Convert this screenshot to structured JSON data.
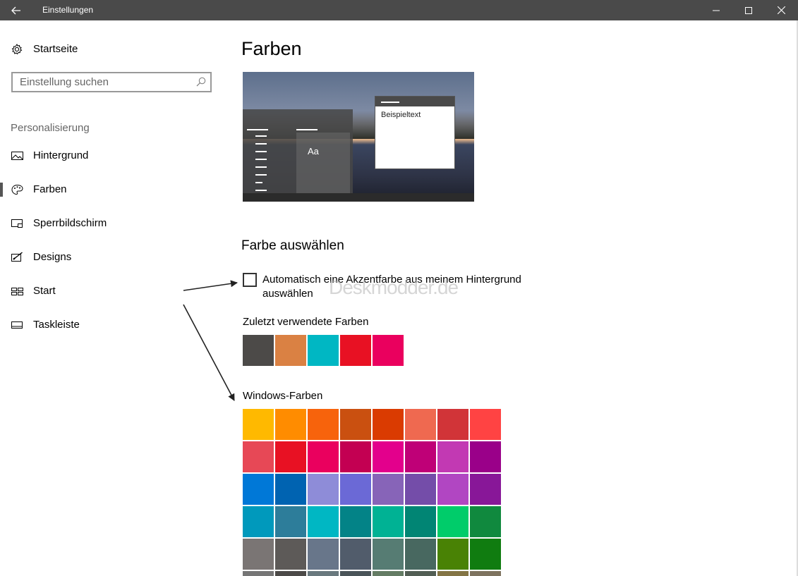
{
  "window": {
    "title": "Einstellungen"
  },
  "sidebar": {
    "home_label": "Startseite",
    "search_placeholder": "Einstellung suchen",
    "section_label": "Personalisierung",
    "items": [
      {
        "label": "Hintergrund",
        "icon": "image-icon"
      },
      {
        "label": "Farben",
        "icon": "palette-icon",
        "selected": true
      },
      {
        "label": "Sperrbildschirm",
        "icon": "lock-screen-icon"
      },
      {
        "label": "Designs",
        "icon": "brush-icon"
      },
      {
        "label": "Start",
        "icon": "start-tiles-icon"
      },
      {
        "label": "Taskleiste",
        "icon": "taskbar-icon"
      }
    ]
  },
  "main": {
    "title": "Farben",
    "preview": {
      "sample_text": "Beispieltext",
      "tile_text": "Aa"
    },
    "choose_heading": "Farbe auswählen",
    "auto_accent_label": "Automatisch eine Akzentfarbe aus meinem Hintergrund auswählen",
    "auto_accent_checked": false,
    "watermark": "Deskmodder.de",
    "recent_label": "Zuletzt verwendete Farben",
    "recent_colors": [
      "#4c4a48",
      "#da8143",
      "#00b7c3",
      "#e81123",
      "#ea005e"
    ],
    "windows_colors_label": "Windows-Farben",
    "windows_colors": [
      "#ffb900",
      "#ff8c00",
      "#f7630c",
      "#ca5010",
      "#da3b01",
      "#ef6950",
      "#d13438",
      "#ff4343",
      "#e74856",
      "#e81123",
      "#ea005e",
      "#c30052",
      "#e3008c",
      "#bf0077",
      "#c239b3",
      "#9a0089",
      "#0078d7",
      "#0063b1",
      "#8e8cd8",
      "#6b69d6",
      "#8764b8",
      "#744da9",
      "#b146c2",
      "#881798",
      "#0099bc",
      "#2d7d9a",
      "#00b7c3",
      "#038387",
      "#00b294",
      "#018574",
      "#00cc6a",
      "#10893e",
      "#7a7574",
      "#5d5a58",
      "#68768a",
      "#515c6b",
      "#567c73",
      "#486860",
      "#498205",
      "#107c10",
      "#767676",
      "#4c4a48",
      "#69797e",
      "#4a5459",
      "#647c64",
      "#525e54",
      "#847545",
      "#7e735f"
    ]
  }
}
